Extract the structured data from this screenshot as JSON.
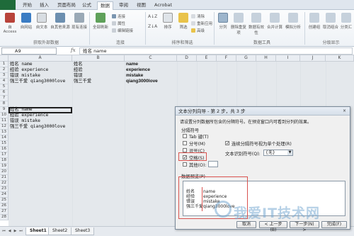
{
  "ribbon": {
    "tabs": [
      "开始",
      "插入",
      "页面布局",
      "公式",
      "数据",
      "审阅",
      "视图",
      "Acrobat"
    ],
    "active_tab": "数据",
    "get_external": {
      "buttons": [
        "自 Access",
        "自网站",
        "自文本",
        "自其他来源",
        "现有连接"
      ],
      "label": "获取外部数据"
    },
    "connections": {
      "refresh": "全部刷新",
      "items": [
        "连接",
        "属性",
        "编辑链接"
      ],
      "label": "连接"
    },
    "sort_filter": {
      "sort": "排序",
      "filter": "筛选",
      "items": [
        "清除",
        "重新应用",
        "高级"
      ],
      "label": "排序和筛选"
    },
    "data_tools": {
      "buttons": [
        "分列",
        "删除重复项",
        "数据有效性",
        "合并计算",
        "模拟分析"
      ],
      "label": "数据工具"
    },
    "outline": {
      "buttons": [
        "创建组",
        "取消组合",
        "分类汇"
      ],
      "label": "分级显示"
    }
  },
  "formula_bar": {
    "name_box": "A9",
    "fx": "fx",
    "content": "姓名 name"
  },
  "grid": {
    "columns": [
      "A",
      "B",
      "C",
      "D",
      "E",
      "F",
      "G",
      "H",
      "I",
      "J",
      "K"
    ],
    "rows": [
      "1",
      "2",
      "3",
      "4",
      "5",
      "6",
      "7",
      "8",
      "9",
      "10",
      "11",
      "12",
      "13",
      "14",
      "15",
      "16",
      "17",
      "18",
      "19",
      "20",
      "21",
      "22",
      "23",
      "24",
      "25",
      "26",
      "27",
      "28"
    ],
    "data": {
      "r1": [
        "姓名 name",
        "姓名",
        "name"
      ],
      "r2": [
        "经验 experience",
        "经验",
        "experience"
      ],
      "r3": [
        "错误 mistake",
        "错误",
        "mistake"
      ],
      "r4": [
        "强三千爱 qiang3000love",
        "强三千爱",
        "qiang3000love"
      ],
      "r9": "姓名 name",
      "r10": "经验 experience",
      "r11": "错误 mistake",
      "r12": "强三千爱 qiang3000love"
    }
  },
  "sheets": {
    "tabs": [
      "Sheet1",
      "Sheet2",
      "Sheet3"
    ],
    "active": "Sheet1",
    "status": "就绪",
    "zoom": "100%"
  },
  "wizard": {
    "title": "文本分列向导 - 第 2 步，共 3 步",
    "close": "×",
    "instruction": "请设置分列数据所包含的分隔符号。在预览窗口内可看到分列的效果。",
    "delim_label": "分隔符号",
    "options": [
      {
        "label": "Tab 键(T)",
        "checked": false
      },
      {
        "label": "分号(M)",
        "checked": false
      },
      {
        "label": "逗号(C)",
        "checked": false
      },
      {
        "label": "空格(S)",
        "checked": true
      },
      {
        "label": "其他(O):",
        "checked": false
      }
    ],
    "consecutive": "连续分隔符号视为单个处理(R)",
    "consecutive_checked": true,
    "qualifier_label": "文本识别符号(Q):",
    "qualifier_value": "{无}",
    "preview_label": "数据预览(P)",
    "preview_rows": [
      [
        "姓名",
        "name"
      ],
      [
        "经验",
        "experience"
      ],
      [
        "错误",
        "mistake"
      ],
      [
        "强三千爱",
        "qiang3000love"
      ]
    ],
    "buttons": [
      "取消",
      "< 上一步(B)",
      "下一步(N) >",
      "完成(F)"
    ]
  },
  "watermark": "我爱IT技术网",
  "colors": {
    "file_tab": "#1f6b3a",
    "accent_red": "#d9534f",
    "watermark": "#78aad2"
  }
}
